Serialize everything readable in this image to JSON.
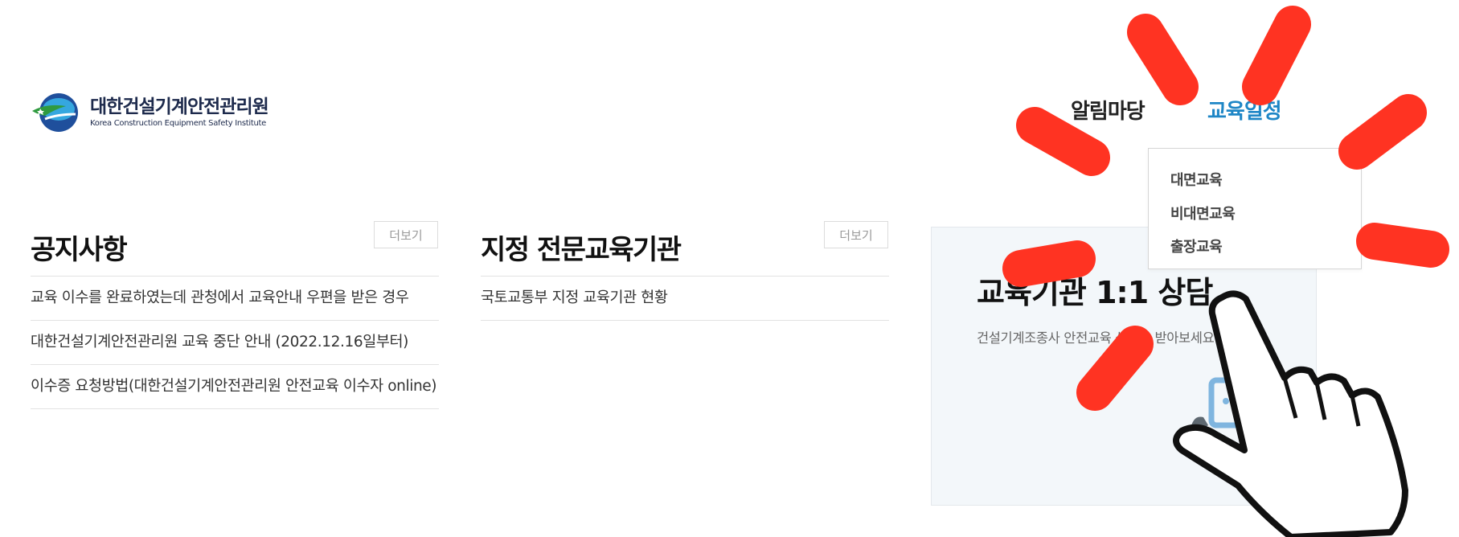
{
  "logo": {
    "name_ko": "대한건설기계안전관리원",
    "name_en": "Korea Construction Equipment Safety Institute"
  },
  "nav": {
    "items": [
      {
        "label": "알림마당"
      },
      {
        "label": "교육일정"
      }
    ],
    "active_color": "#1e86c6"
  },
  "dropdown": {
    "items": [
      {
        "label": "대면교육"
      },
      {
        "label": "비대면교육"
      },
      {
        "label": "출장교육"
      }
    ]
  },
  "notice": {
    "title": "공지사항",
    "more_label": "더보기",
    "items": [
      {
        "text": "교육 이수를 완료하였는데 관청에서 교육안내 우편을 받은 경우"
      },
      {
        "text": "대한건설기계안전관리원 교육 중단 안내 (2022.12.16일부터)"
      },
      {
        "text": "이수증 요청방법(대한건설기계안전관리원 안전교육 이수자 online)"
      }
    ]
  },
  "institutions": {
    "title": "지정 전문교육기관",
    "more_label": "더보기",
    "items": [
      {
        "text": "국토교통부 지정 교육기관 현황"
      }
    ]
  },
  "consult": {
    "title": "교육기관 1:1 상담",
    "description": "건설기계조종사 안전교육 상담을 받아보세요"
  },
  "icons": {
    "logo_mark": "logo-emblem-icon",
    "consult": "phone-consult-icon",
    "pointer": "hand-pointer-icon"
  },
  "colors": {
    "burst": "#ff3322",
    "consult_bg": "#f3f7fa"
  }
}
